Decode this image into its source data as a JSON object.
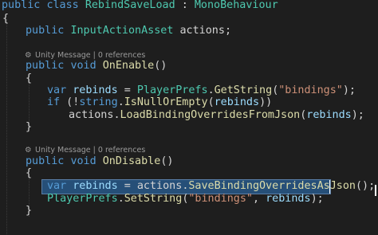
{
  "editor": {
    "line_class": {
      "kw_public": "public",
      "kw_class": "class",
      "class_name": "RebindSaveLoad",
      "colon": " : ",
      "base_class": "MonoBehaviour"
    },
    "brace_open": "{",
    "brace_close": "}",
    "field": {
      "kw_public": "public",
      "type": "InputActionAsset",
      "name": "actions",
      "end": ";"
    },
    "codelens_1": "Unity Message | 0 references",
    "on_enable": {
      "kw_public": "public",
      "kw_void": "void",
      "name": "OnEnable",
      "parens": "()"
    },
    "line_rebinds_get": {
      "kw_var": "var",
      "var_name": "rebinds",
      "eq": " = ",
      "cls": "PlayerPrefs",
      "dot": ".",
      "method": "GetString",
      "open": "(",
      "arg": "\"bindings\"",
      "close": ");"
    },
    "line_if": {
      "kw_if": "if",
      "open": " (!",
      "kw_string": "string",
      "dot": ".",
      "method": "IsNullOrEmpty",
      "arg_open": "(",
      "arg": "rebinds",
      "close": "))"
    },
    "line_load": {
      "obj": "actions",
      "dot": ".",
      "method": "LoadBindingOverridesFromJson",
      "open": "(",
      "arg": "rebinds",
      "close": ");"
    },
    "codelens_2": "Unity Message | 0 references",
    "on_disable": {
      "kw_public": "public",
      "kw_void": "void",
      "name": "OnDisable",
      "parens": "()"
    },
    "line_rebinds_save": {
      "kw_var": "var",
      "var_name": "rebinds",
      "eq": " = ",
      "obj": "actions",
      "dot": ".",
      "method": "SaveBindingOverridesAsJson",
      "close": "();"
    },
    "line_setstring": {
      "cls": "PlayerPrefs",
      "dot": ".",
      "method": "SetString",
      "open": "(",
      "arg1": "\"bindings\"",
      "comma": ", ",
      "arg2": "rebinds",
      "close": ");"
    }
  },
  "icons": {
    "codelens_icon": "gear-icon"
  },
  "colors": {
    "background": "#1e1e1e",
    "keyword": "#569cd6",
    "type": "#4ec9b0",
    "method": "#dcdcaa",
    "string": "#ce9178",
    "identifier": "#9cdcfe",
    "selection": "#264f78"
  }
}
